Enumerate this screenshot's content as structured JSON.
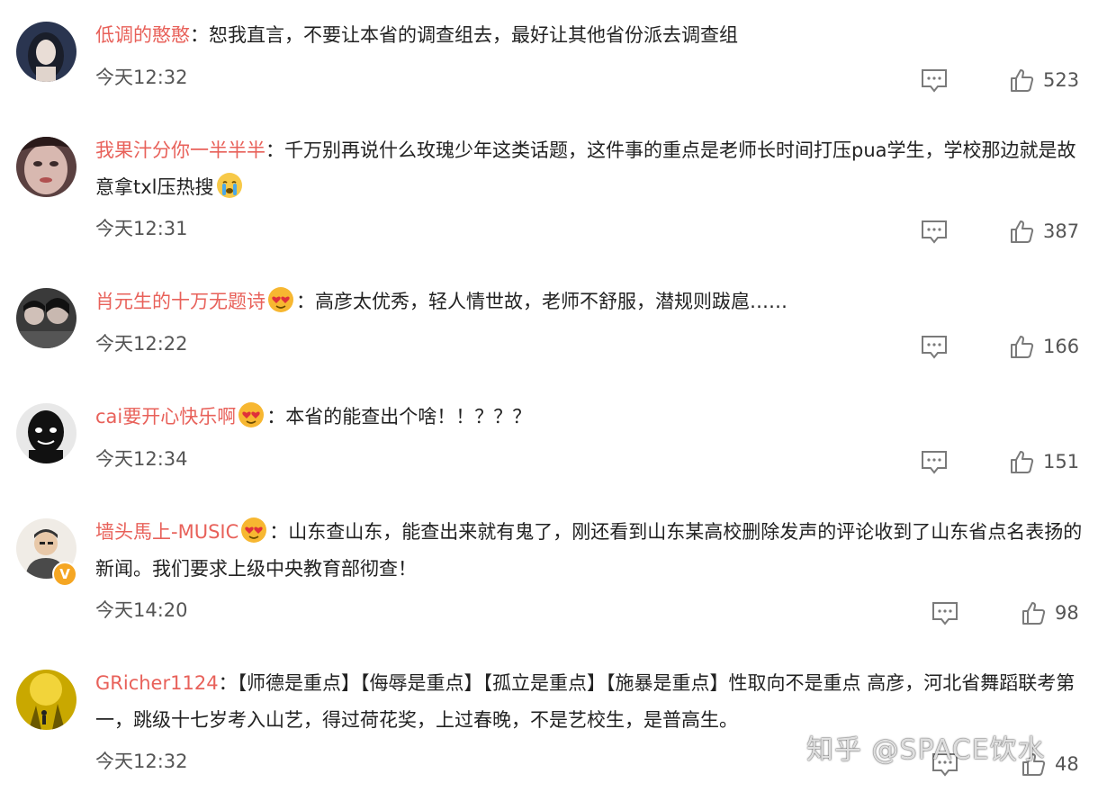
{
  "comments": [
    {
      "username": "低调的憨憨",
      "separator": "：",
      "text": "恕我直言，不要让本省的调查组去，最好让其他省份派去调查组",
      "time": "今天12:32",
      "likes": "523",
      "avatar": "dark-hair-woman-avatar",
      "badge": "",
      "verified": false
    },
    {
      "username": "我果汁分你一半半半",
      "separator": "：",
      "text": "千万别再说什么玫瑰少年这类话题，这件事的重点是老师长时间打压pua学生，学校那边就是故意拿txl压热搜",
      "time": "今天12:31",
      "likes": "387",
      "avatar": "face-closeup-avatar",
      "badge": "crying-face-emoji",
      "verified": false
    },
    {
      "username": "肖元生的十万无题诗",
      "separator": "：",
      "text": "高彦太优秀，轻人情世故，老师不舒服，潜规则跋扈……",
      "time": "今天12:22",
      "likes": "166",
      "avatar": "two-people-avatar",
      "badge": "heart-eyes-emoji",
      "verified": false
    },
    {
      "username": "cai要开心快乐啊",
      "separator": "：",
      "text": "本省的能查出个啥！！？？？",
      "time": "今天12:34",
      "likes": "151",
      "avatar": "black-mask-avatar",
      "badge": "heart-eyes-emoji",
      "verified": false
    },
    {
      "username": "墙头馬上-MUSIC",
      "separator": "：",
      "text": "山东查山东，能查出来就有鬼了，刚还看到山东某高校删除发声的评论收到了山东省点名表扬的新闻。我们要求上级中央教育部彻查！",
      "time": "今天14:20",
      "likes": "98",
      "avatar": "cartoon-man-avatar",
      "badge": "heart-eyes-emoji",
      "verified": true,
      "verified_mark": "V"
    },
    {
      "username": "GRicher1124",
      "separator": "：",
      "text": "【师德是重点】【侮辱是重点】【孤立是重点】【施暴是重点】性取向不是重点 高彦，河北省舞蹈联考第一，跳级十七岁考入山艺，得过荷花奖，上过春晚，不是艺校生，是普高生。",
      "time": "今天12:32",
      "likes": "48",
      "avatar": "yellow-stage-avatar",
      "badge": "",
      "verified": false
    }
  ],
  "watermark": "知乎 @SPACE饮水",
  "colors": {
    "username": "#e8615a",
    "text": "#222222",
    "meta": "#555555",
    "icon": "#7a7a7a"
  }
}
